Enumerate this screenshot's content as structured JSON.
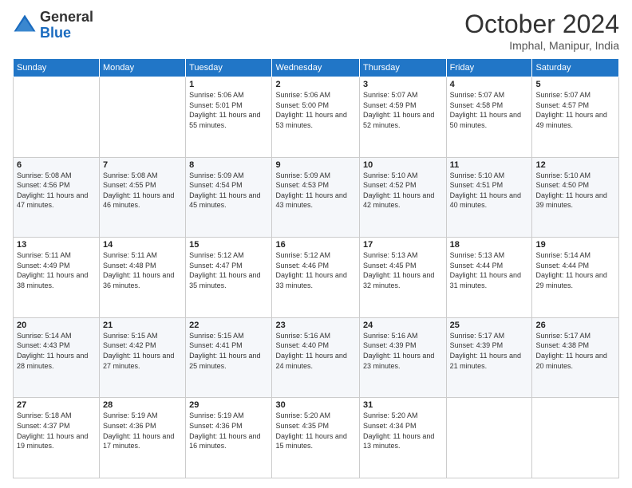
{
  "logo": {
    "general": "General",
    "blue": "Blue"
  },
  "title": "October 2024",
  "subtitle": "Imphal, Manipur, India",
  "weekdays": [
    "Sunday",
    "Monday",
    "Tuesday",
    "Wednesday",
    "Thursday",
    "Friday",
    "Saturday"
  ],
  "weeks": [
    [
      {
        "day": "",
        "sunrise": "",
        "sunset": "",
        "daylight": ""
      },
      {
        "day": "",
        "sunrise": "",
        "sunset": "",
        "daylight": ""
      },
      {
        "day": "1",
        "sunrise": "Sunrise: 5:06 AM",
        "sunset": "Sunset: 5:01 PM",
        "daylight": "Daylight: 11 hours and 55 minutes."
      },
      {
        "day": "2",
        "sunrise": "Sunrise: 5:06 AM",
        "sunset": "Sunset: 5:00 PM",
        "daylight": "Daylight: 11 hours and 53 minutes."
      },
      {
        "day": "3",
        "sunrise": "Sunrise: 5:07 AM",
        "sunset": "Sunset: 4:59 PM",
        "daylight": "Daylight: 11 hours and 52 minutes."
      },
      {
        "day": "4",
        "sunrise": "Sunrise: 5:07 AM",
        "sunset": "Sunset: 4:58 PM",
        "daylight": "Daylight: 11 hours and 50 minutes."
      },
      {
        "day": "5",
        "sunrise": "Sunrise: 5:07 AM",
        "sunset": "Sunset: 4:57 PM",
        "daylight": "Daylight: 11 hours and 49 minutes."
      }
    ],
    [
      {
        "day": "6",
        "sunrise": "Sunrise: 5:08 AM",
        "sunset": "Sunset: 4:56 PM",
        "daylight": "Daylight: 11 hours and 47 minutes."
      },
      {
        "day": "7",
        "sunrise": "Sunrise: 5:08 AM",
        "sunset": "Sunset: 4:55 PM",
        "daylight": "Daylight: 11 hours and 46 minutes."
      },
      {
        "day": "8",
        "sunrise": "Sunrise: 5:09 AM",
        "sunset": "Sunset: 4:54 PM",
        "daylight": "Daylight: 11 hours and 45 minutes."
      },
      {
        "day": "9",
        "sunrise": "Sunrise: 5:09 AM",
        "sunset": "Sunset: 4:53 PM",
        "daylight": "Daylight: 11 hours and 43 minutes."
      },
      {
        "day": "10",
        "sunrise": "Sunrise: 5:10 AM",
        "sunset": "Sunset: 4:52 PM",
        "daylight": "Daylight: 11 hours and 42 minutes."
      },
      {
        "day": "11",
        "sunrise": "Sunrise: 5:10 AM",
        "sunset": "Sunset: 4:51 PM",
        "daylight": "Daylight: 11 hours and 40 minutes."
      },
      {
        "day": "12",
        "sunrise": "Sunrise: 5:10 AM",
        "sunset": "Sunset: 4:50 PM",
        "daylight": "Daylight: 11 hours and 39 minutes."
      }
    ],
    [
      {
        "day": "13",
        "sunrise": "Sunrise: 5:11 AM",
        "sunset": "Sunset: 4:49 PM",
        "daylight": "Daylight: 11 hours and 38 minutes."
      },
      {
        "day": "14",
        "sunrise": "Sunrise: 5:11 AM",
        "sunset": "Sunset: 4:48 PM",
        "daylight": "Daylight: 11 hours and 36 minutes."
      },
      {
        "day": "15",
        "sunrise": "Sunrise: 5:12 AM",
        "sunset": "Sunset: 4:47 PM",
        "daylight": "Daylight: 11 hours and 35 minutes."
      },
      {
        "day": "16",
        "sunrise": "Sunrise: 5:12 AM",
        "sunset": "Sunset: 4:46 PM",
        "daylight": "Daylight: 11 hours and 33 minutes."
      },
      {
        "day": "17",
        "sunrise": "Sunrise: 5:13 AM",
        "sunset": "Sunset: 4:45 PM",
        "daylight": "Daylight: 11 hours and 32 minutes."
      },
      {
        "day": "18",
        "sunrise": "Sunrise: 5:13 AM",
        "sunset": "Sunset: 4:44 PM",
        "daylight": "Daylight: 11 hours and 31 minutes."
      },
      {
        "day": "19",
        "sunrise": "Sunrise: 5:14 AM",
        "sunset": "Sunset: 4:44 PM",
        "daylight": "Daylight: 11 hours and 29 minutes."
      }
    ],
    [
      {
        "day": "20",
        "sunrise": "Sunrise: 5:14 AM",
        "sunset": "Sunset: 4:43 PM",
        "daylight": "Daylight: 11 hours and 28 minutes."
      },
      {
        "day": "21",
        "sunrise": "Sunrise: 5:15 AM",
        "sunset": "Sunset: 4:42 PM",
        "daylight": "Daylight: 11 hours and 27 minutes."
      },
      {
        "day": "22",
        "sunrise": "Sunrise: 5:15 AM",
        "sunset": "Sunset: 4:41 PM",
        "daylight": "Daylight: 11 hours and 25 minutes."
      },
      {
        "day": "23",
        "sunrise": "Sunrise: 5:16 AM",
        "sunset": "Sunset: 4:40 PM",
        "daylight": "Daylight: 11 hours and 24 minutes."
      },
      {
        "day": "24",
        "sunrise": "Sunrise: 5:16 AM",
        "sunset": "Sunset: 4:39 PM",
        "daylight": "Daylight: 11 hours and 23 minutes."
      },
      {
        "day": "25",
        "sunrise": "Sunrise: 5:17 AM",
        "sunset": "Sunset: 4:39 PM",
        "daylight": "Daylight: 11 hours and 21 minutes."
      },
      {
        "day": "26",
        "sunrise": "Sunrise: 5:17 AM",
        "sunset": "Sunset: 4:38 PM",
        "daylight": "Daylight: 11 hours and 20 minutes."
      }
    ],
    [
      {
        "day": "27",
        "sunrise": "Sunrise: 5:18 AM",
        "sunset": "Sunset: 4:37 PM",
        "daylight": "Daylight: 11 hours and 19 minutes."
      },
      {
        "day": "28",
        "sunrise": "Sunrise: 5:19 AM",
        "sunset": "Sunset: 4:36 PM",
        "daylight": "Daylight: 11 hours and 17 minutes."
      },
      {
        "day": "29",
        "sunrise": "Sunrise: 5:19 AM",
        "sunset": "Sunset: 4:36 PM",
        "daylight": "Daylight: 11 hours and 16 minutes."
      },
      {
        "day": "30",
        "sunrise": "Sunrise: 5:20 AM",
        "sunset": "Sunset: 4:35 PM",
        "daylight": "Daylight: 11 hours and 15 minutes."
      },
      {
        "day": "31",
        "sunrise": "Sunrise: 5:20 AM",
        "sunset": "Sunset: 4:34 PM",
        "daylight": "Daylight: 11 hours and 13 minutes."
      },
      {
        "day": "",
        "sunrise": "",
        "sunset": "",
        "daylight": ""
      },
      {
        "day": "",
        "sunrise": "",
        "sunset": "",
        "daylight": ""
      }
    ]
  ]
}
